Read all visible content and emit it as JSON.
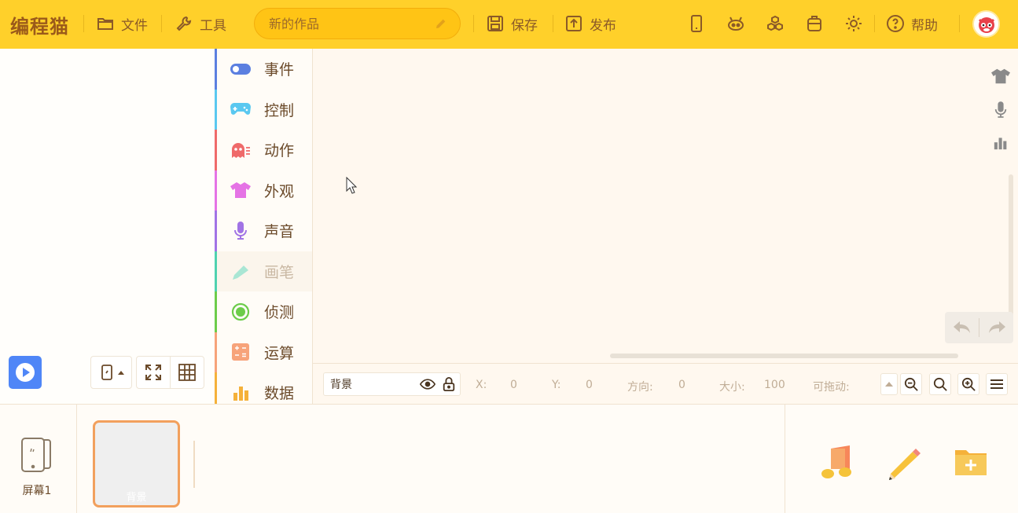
{
  "topbar": {
    "logo": "编程猫",
    "file_label": "文件",
    "tools_label": "工具",
    "title_placeholder": "新的作品",
    "save_label": "保存",
    "publish_label": "发布",
    "help_label": "帮助"
  },
  "categories": [
    {
      "label": "事件",
      "color": "#5b7fe0",
      "icon": "toggle-icon"
    },
    {
      "label": "控制",
      "color": "#5ac8f0",
      "icon": "gamepad-icon"
    },
    {
      "label": "动作",
      "color": "#ef6a6a",
      "icon": "ghost-icon"
    },
    {
      "label": "外观",
      "color": "#e573e5",
      "icon": "shirt-icon"
    },
    {
      "label": "声音",
      "color": "#a173e5",
      "icon": "microphone-icon"
    },
    {
      "label": "画笔",
      "color": "#4fd2b0",
      "icon": "pen-icon",
      "disabled": true
    },
    {
      "label": "侦测",
      "color": "#6ccc4a",
      "icon": "target-icon"
    },
    {
      "label": "运算",
      "color": "#f7a37a",
      "icon": "math-icon"
    },
    {
      "label": "数据",
      "color": "#f5b13a",
      "icon": "chart-icon"
    }
  ],
  "props": {
    "sprite_name": "背景",
    "x_label": "X:",
    "x_value": "0",
    "y_label": "Y:",
    "y_value": "0",
    "direction_label": "方向:",
    "direction_value": "0",
    "size_label": "大小:",
    "size_value": "100",
    "draggable_label": "可拖动:"
  },
  "bottom": {
    "screen_label": "屏幕1",
    "background_label": "背景"
  },
  "colors": {
    "topbar": "#ffd02a",
    "accent_brown": "#8b5a28",
    "run_button": "#4f86f7"
  }
}
